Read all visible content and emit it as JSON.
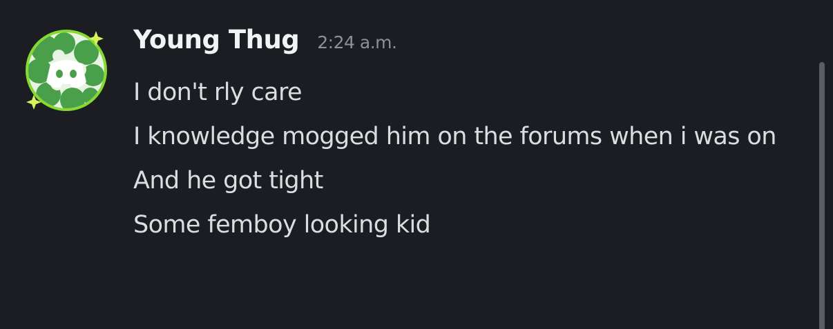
{
  "message": {
    "author": "Young Thug",
    "timestamp": "2:24 a.m.",
    "lines": [
      "I don't rly care",
      "I knowledge mogged him on the forums when i was on",
      "And he got tight",
      "Some femboy looking kid"
    ]
  },
  "colors": {
    "background": "#1c1d22",
    "username": "#f2f3f5",
    "timestamp": "#8e9099",
    "text": "#dbdee1",
    "avatar_ring": "#86d92f",
    "avatar_green": "#4aa04a"
  },
  "icons": {
    "avatar": "discord-default-avatar-icon"
  }
}
